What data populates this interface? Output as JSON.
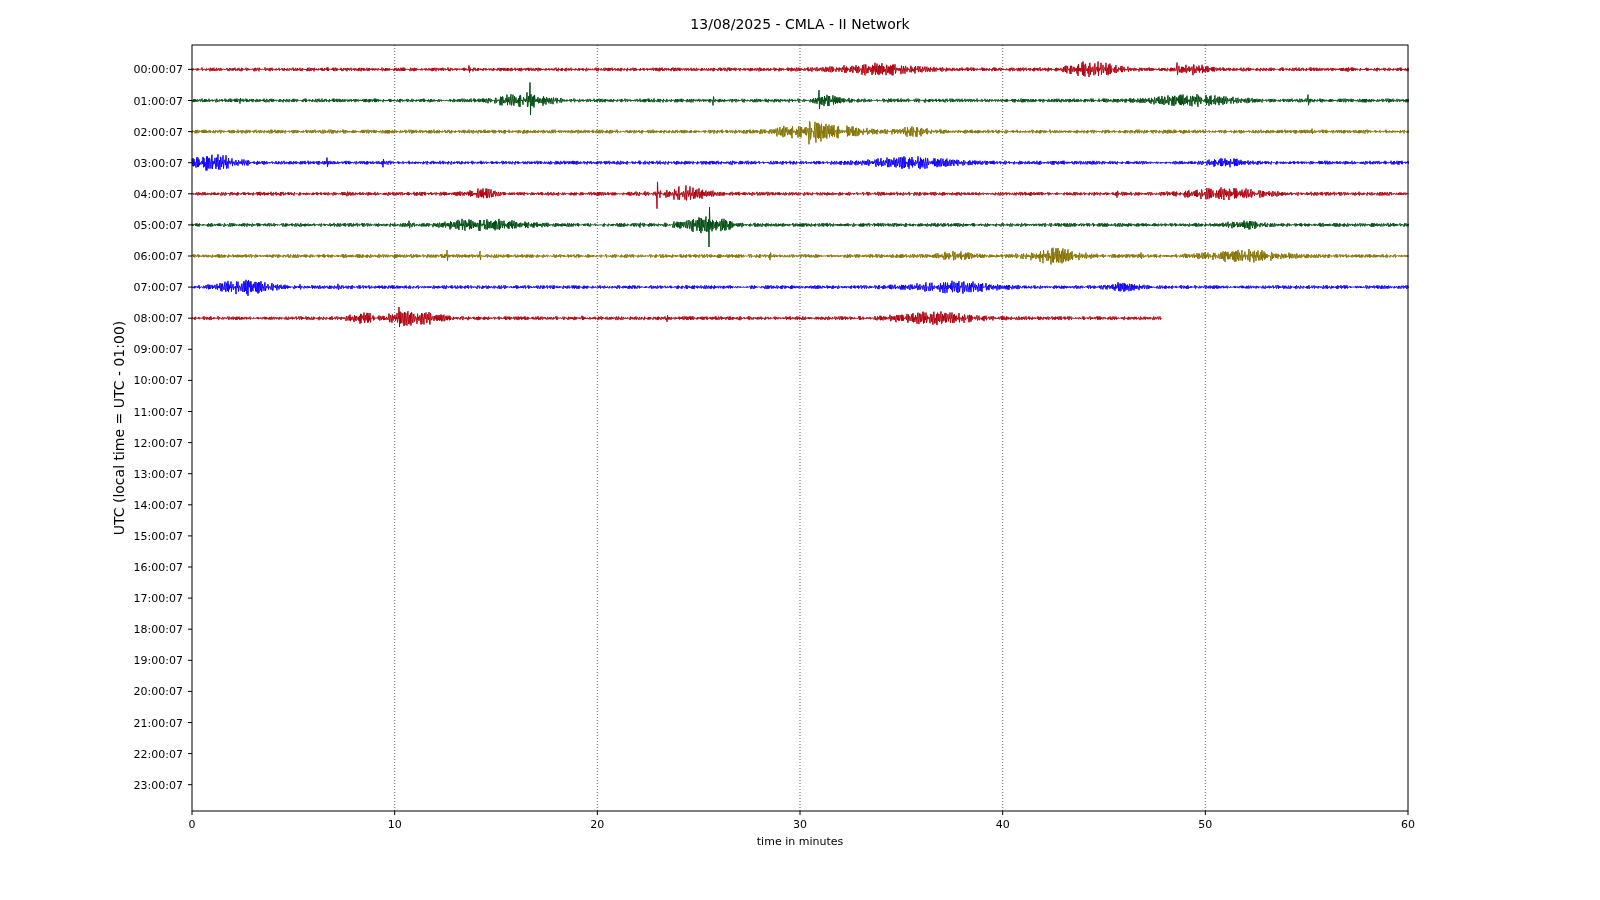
{
  "title": "13/08/2025 - CMLA - II Network",
  "ylabel": "UTC (local time = UTC - 01:00)",
  "xlabel": "time in minutes",
  "xticks": [
    "0",
    "10",
    "20",
    "30",
    "40",
    "50",
    "60"
  ],
  "hours": [
    {
      "label": "00:00:07",
      "trace": {
        "color": "#b2000f",
        "level": 1
      }
    },
    {
      "label": "01:00:07",
      "trace": {
        "color": "#004c12",
        "level": 1
      }
    },
    {
      "label": "02:00:07",
      "trace": {
        "color": "#847200",
        "level": 1
      }
    },
    {
      "label": "03:00:07",
      "trace": {
        "color": "#0e01ff",
        "level": 1
      }
    },
    {
      "label": "04:00:07",
      "trace": {
        "color": "#b2000f",
        "level": 1
      }
    },
    {
      "label": "05:00:07",
      "trace": {
        "color": "#004c12",
        "level": 1
      }
    },
    {
      "label": "06:00:07",
      "trace": {
        "color": "#847200",
        "level": 1
      }
    },
    {
      "label": "07:00:07",
      "trace": {
        "color": "#0e01ff",
        "level": 1
      }
    },
    {
      "label": "08:00:07",
      "trace": {
        "color": "#b2000f",
        "level": 0.797
      }
    },
    {
      "label": "09:00:07"
    },
    {
      "label": "10:00:07"
    },
    {
      "label": "11:00:07"
    },
    {
      "label": "12:00:07"
    },
    {
      "label": "13:00:07"
    },
    {
      "label": "14:00:07"
    },
    {
      "label": "15:00:07"
    },
    {
      "label": "16:00:07"
    },
    {
      "label": "17:00:07"
    },
    {
      "label": "18:00:07"
    },
    {
      "label": "19:00:07"
    },
    {
      "label": "20:00:07"
    },
    {
      "label": "21:00:07"
    },
    {
      "label": "22:00:07"
    },
    {
      "label": "23:00:07"
    }
  ]
}
